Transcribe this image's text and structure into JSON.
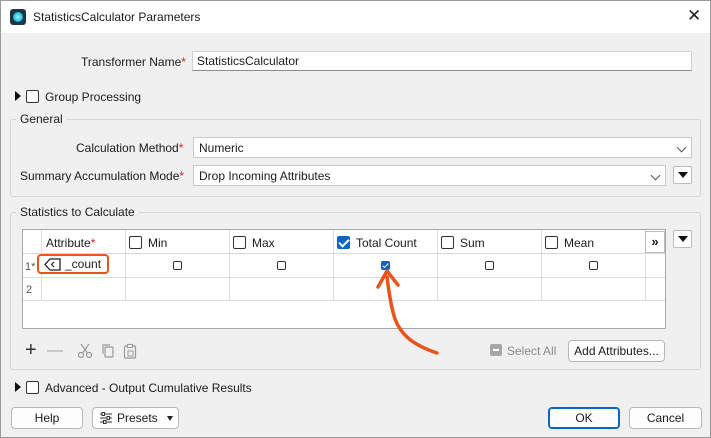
{
  "window": {
    "title": "StatisticsCalculator Parameters",
    "close_glyph": "✕"
  },
  "transformer_name": {
    "label": "Transformer Name",
    "value": "StatisticsCalculator"
  },
  "group_processing": {
    "label": "Group Processing",
    "checked": false
  },
  "general": {
    "legend": "General",
    "calc_method": {
      "label": "Calculation Method",
      "value": "Numeric"
    },
    "summary_mode": {
      "label": "Summary Accumulation Mode",
      "value": "Drop Incoming Attributes"
    }
  },
  "stats": {
    "legend": "Statistics to Calculate",
    "columns": [
      {
        "label": "Attribute",
        "required": true
      },
      {
        "label": "Min",
        "checked": false
      },
      {
        "label": "Max",
        "checked": false
      },
      {
        "label": "Total Count",
        "checked": true
      },
      {
        "label": "Sum",
        "checked": false
      },
      {
        "label": "Mean",
        "checked": false
      }
    ],
    "more_label": "»",
    "rows": [
      {
        "num": "1*",
        "attribute": "_count",
        "min": false,
        "max": false,
        "total_count": true,
        "sum": false,
        "mean": false
      },
      {
        "num": "2"
      }
    ],
    "toolbar": {
      "add": "+",
      "remove": "—",
      "select_all_label": "Select All",
      "add_attributes_label": "Add Attributes..."
    }
  },
  "advanced": {
    "label": "Advanced - Output Cumulative Results",
    "checked": false
  },
  "footer": {
    "help": "Help",
    "presets": "Presets",
    "ok": "OK",
    "cancel": "Cancel"
  },
  "colors": {
    "accent": "#0a66c2",
    "annotation": "#e9541b",
    "required": "#d32424"
  }
}
